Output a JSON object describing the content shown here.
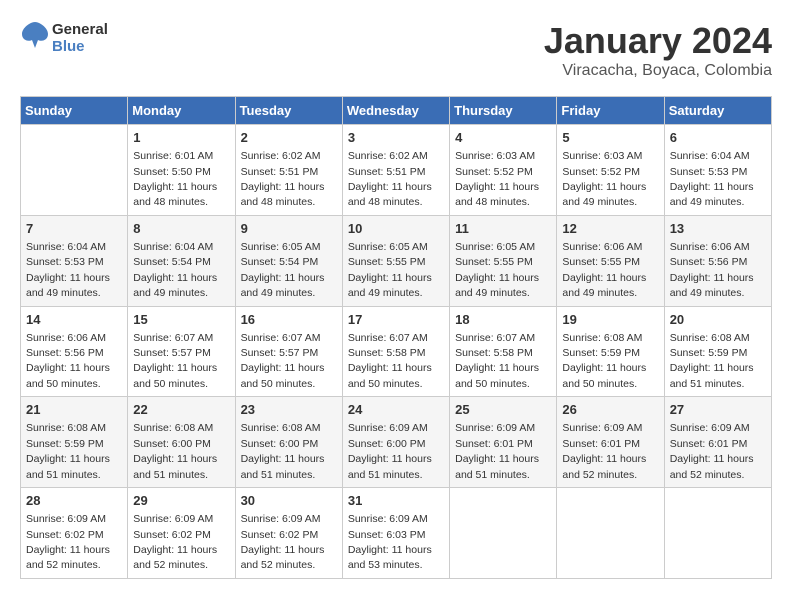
{
  "header": {
    "logo_line1": "General",
    "logo_line2": "Blue",
    "month": "January 2024",
    "location": "Viracacha, Boyaca, Colombia"
  },
  "days_of_week": [
    "Sunday",
    "Monday",
    "Tuesday",
    "Wednesday",
    "Thursday",
    "Friday",
    "Saturday"
  ],
  "weeks": [
    [
      {
        "day": "",
        "sunrise": "",
        "sunset": "",
        "daylight": ""
      },
      {
        "day": "1",
        "sunrise": "6:01 AM",
        "sunset": "5:50 PM",
        "daylight": "11 hours and 48 minutes."
      },
      {
        "day": "2",
        "sunrise": "6:02 AM",
        "sunset": "5:51 PM",
        "daylight": "11 hours and 48 minutes."
      },
      {
        "day": "3",
        "sunrise": "6:02 AM",
        "sunset": "5:51 PM",
        "daylight": "11 hours and 48 minutes."
      },
      {
        "day": "4",
        "sunrise": "6:03 AM",
        "sunset": "5:52 PM",
        "daylight": "11 hours and 48 minutes."
      },
      {
        "day": "5",
        "sunrise": "6:03 AM",
        "sunset": "5:52 PM",
        "daylight": "11 hours and 49 minutes."
      },
      {
        "day": "6",
        "sunrise": "6:04 AM",
        "sunset": "5:53 PM",
        "daylight": "11 hours and 49 minutes."
      }
    ],
    [
      {
        "day": "7",
        "sunrise": "6:04 AM",
        "sunset": "5:53 PM",
        "daylight": "11 hours and 49 minutes."
      },
      {
        "day": "8",
        "sunrise": "6:04 AM",
        "sunset": "5:54 PM",
        "daylight": "11 hours and 49 minutes."
      },
      {
        "day": "9",
        "sunrise": "6:05 AM",
        "sunset": "5:54 PM",
        "daylight": "11 hours and 49 minutes."
      },
      {
        "day": "10",
        "sunrise": "6:05 AM",
        "sunset": "5:55 PM",
        "daylight": "11 hours and 49 minutes."
      },
      {
        "day": "11",
        "sunrise": "6:05 AM",
        "sunset": "5:55 PM",
        "daylight": "11 hours and 49 minutes."
      },
      {
        "day": "12",
        "sunrise": "6:06 AM",
        "sunset": "5:55 PM",
        "daylight": "11 hours and 49 minutes."
      },
      {
        "day": "13",
        "sunrise": "6:06 AM",
        "sunset": "5:56 PM",
        "daylight": "11 hours and 49 minutes."
      }
    ],
    [
      {
        "day": "14",
        "sunrise": "6:06 AM",
        "sunset": "5:56 PM",
        "daylight": "11 hours and 50 minutes."
      },
      {
        "day": "15",
        "sunrise": "6:07 AM",
        "sunset": "5:57 PM",
        "daylight": "11 hours and 50 minutes."
      },
      {
        "day": "16",
        "sunrise": "6:07 AM",
        "sunset": "5:57 PM",
        "daylight": "11 hours and 50 minutes."
      },
      {
        "day": "17",
        "sunrise": "6:07 AM",
        "sunset": "5:58 PM",
        "daylight": "11 hours and 50 minutes."
      },
      {
        "day": "18",
        "sunrise": "6:07 AM",
        "sunset": "5:58 PM",
        "daylight": "11 hours and 50 minutes."
      },
      {
        "day": "19",
        "sunrise": "6:08 AM",
        "sunset": "5:59 PM",
        "daylight": "11 hours and 50 minutes."
      },
      {
        "day": "20",
        "sunrise": "6:08 AM",
        "sunset": "5:59 PM",
        "daylight": "11 hours and 51 minutes."
      }
    ],
    [
      {
        "day": "21",
        "sunrise": "6:08 AM",
        "sunset": "5:59 PM",
        "daylight": "11 hours and 51 minutes."
      },
      {
        "day": "22",
        "sunrise": "6:08 AM",
        "sunset": "6:00 PM",
        "daylight": "11 hours and 51 minutes."
      },
      {
        "day": "23",
        "sunrise": "6:08 AM",
        "sunset": "6:00 PM",
        "daylight": "11 hours and 51 minutes."
      },
      {
        "day": "24",
        "sunrise": "6:09 AM",
        "sunset": "6:00 PM",
        "daylight": "11 hours and 51 minutes."
      },
      {
        "day": "25",
        "sunrise": "6:09 AM",
        "sunset": "6:01 PM",
        "daylight": "11 hours and 51 minutes."
      },
      {
        "day": "26",
        "sunrise": "6:09 AM",
        "sunset": "6:01 PM",
        "daylight": "11 hours and 52 minutes."
      },
      {
        "day": "27",
        "sunrise": "6:09 AM",
        "sunset": "6:01 PM",
        "daylight": "11 hours and 52 minutes."
      }
    ],
    [
      {
        "day": "28",
        "sunrise": "6:09 AM",
        "sunset": "6:02 PM",
        "daylight": "11 hours and 52 minutes."
      },
      {
        "day": "29",
        "sunrise": "6:09 AM",
        "sunset": "6:02 PM",
        "daylight": "11 hours and 52 minutes."
      },
      {
        "day": "30",
        "sunrise": "6:09 AM",
        "sunset": "6:02 PM",
        "daylight": "11 hours and 52 minutes."
      },
      {
        "day": "31",
        "sunrise": "6:09 AM",
        "sunset": "6:03 PM",
        "daylight": "11 hours and 53 minutes."
      },
      {
        "day": "",
        "sunrise": "",
        "sunset": "",
        "daylight": ""
      },
      {
        "day": "",
        "sunrise": "",
        "sunset": "",
        "daylight": ""
      },
      {
        "day": "",
        "sunrise": "",
        "sunset": "",
        "daylight": ""
      }
    ]
  ]
}
